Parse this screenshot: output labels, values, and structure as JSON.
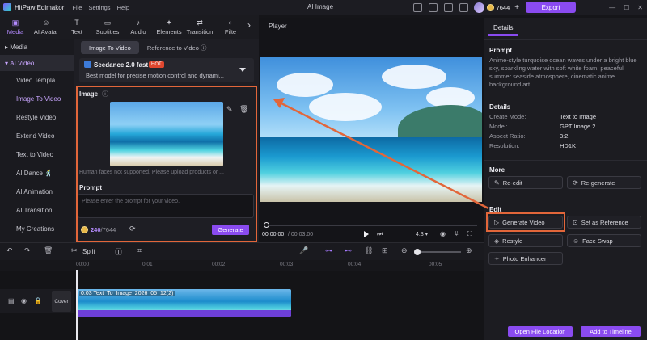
{
  "titlebar": {
    "app_name": "HitPaw Edimakor",
    "menu": [
      "File",
      "Settings",
      "Help"
    ],
    "window_title": "AI Image",
    "credits": "7644",
    "export_label": "Export"
  },
  "toolbar": {
    "tools": [
      {
        "label": "Media",
        "icon": "media-icon",
        "glyph": "▣"
      },
      {
        "label": "AI Avatar",
        "icon": "avatar-icon",
        "glyph": "☺"
      },
      {
        "label": "Text",
        "icon": "text-icon",
        "glyph": "T"
      },
      {
        "label": "Subtitles",
        "icon": "subtitles-icon",
        "glyph": "▭"
      },
      {
        "label": "Audio",
        "icon": "audio-icon",
        "glyph": "♪"
      },
      {
        "label": "Elements",
        "icon": "elements-icon",
        "glyph": "✦"
      },
      {
        "label": "Transition",
        "icon": "transition-icon",
        "glyph": "⇄"
      },
      {
        "label": "Filte",
        "icon": "filter-icon",
        "glyph": "◐"
      }
    ]
  },
  "leftnav": {
    "media": "Media",
    "ai_video": "AI Video",
    "items": [
      "Video Templa...",
      "Image To Video",
      "Restyle Video",
      "Extend Video",
      "Text to Video",
      "AI Dance 🕺",
      "AI Animation",
      "AI Transition",
      "My Creations"
    ]
  },
  "midpanel": {
    "tabs": [
      "Image To Video",
      "Reference to Video"
    ],
    "model_name": "Seedance 2.0 fast",
    "model_badge": "HOT",
    "model_desc": "Best model for precise motion control and dynami...",
    "image_label": "Image",
    "hint": "Human faces not supported. Please upload products or ...",
    "prompt_label": "Prompt",
    "prompt_placeholder": "Please enter the prompt for your video.",
    "cost": "240",
    "cost_total": "/7644",
    "generate_label": "Generate"
  },
  "player": {
    "title": "Player",
    "time_current": "00:00:00",
    "time_total": "/ 00:03:00",
    "ratio": "4:3"
  },
  "details": {
    "tab": "Details",
    "prompt_label": "Prompt",
    "prompt_text": "Anime-style turquoise ocean waves under a bright blue sky, sparkling water with soft white foam, peaceful summer seaside atmosphere, cinematic anime background art.",
    "details_label": "Details",
    "rows": [
      {
        "k": "Create Mode:",
        "v": "Text to Image"
      },
      {
        "k": "Model:",
        "v": "GPT Image 2"
      },
      {
        "k": "Aspect Ratio:",
        "v": "3:2"
      },
      {
        "k": "Resolution:",
        "v": "HD1K"
      }
    ],
    "more_label": "More",
    "re_edit": "Re-edit",
    "re_generate": "Re-generate",
    "edit_label": "Edit",
    "generate_video": "Generate Video",
    "set_reference": "Set as Reference",
    "restyle": "Restyle",
    "face_swap": "Face Swap",
    "photo_enhancer": "Photo Enhancer",
    "open_location": "Open File Location",
    "add_timeline": "Add to Timeline"
  },
  "timeline": {
    "split_label": "Split",
    "ticks": [
      "00:00",
      "0:01",
      "00:02",
      "00:03",
      "00:04",
      "00:05"
    ],
    "cover_label": "Cover",
    "clip_label": "0:03  Text_To_Image_2026_05_12(2)"
  },
  "colors": {
    "accent": "#8a4bf0",
    "highlight": "#e2663a"
  }
}
